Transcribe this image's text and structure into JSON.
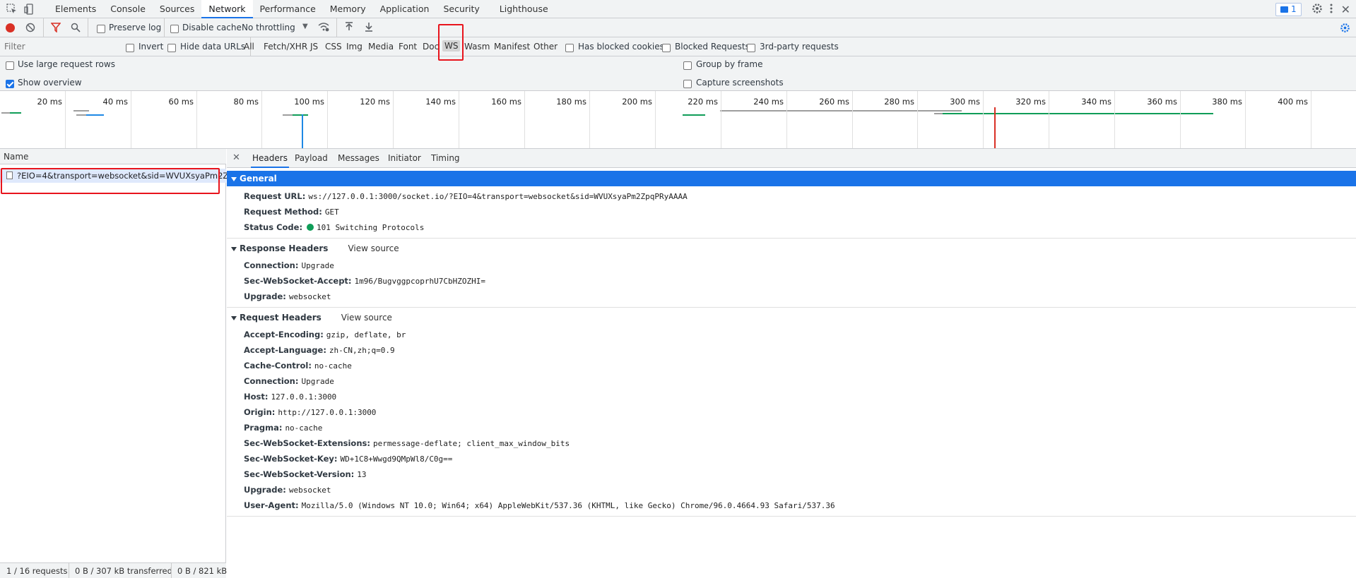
{
  "devtools": {
    "tabs": [
      "Elements",
      "Console",
      "Sources",
      "Network",
      "Performance",
      "Memory",
      "Application",
      "Security",
      "Lighthouse"
    ],
    "active_tab": "Network",
    "issues_badge": "1"
  },
  "toolbar": {
    "preserve_log": "Preserve log",
    "disable_cache": "Disable cache",
    "throttling": "No throttling"
  },
  "filter": {
    "placeholder": "Filter",
    "invert": "Invert",
    "hide_data_urls": "Hide data URLs",
    "types": [
      "All",
      "Fetch/XHR",
      "JS",
      "CSS",
      "Img",
      "Media",
      "Font",
      "Doc",
      "WS",
      "Wasm",
      "Manifest",
      "Other"
    ],
    "active_type": "WS",
    "has_blocked_cookies": "Has blocked cookies",
    "blocked_requests": "Blocked Requests",
    "third_party": "3rd-party requests"
  },
  "options": {
    "large_rows": "Use large request rows",
    "show_overview": "Show overview",
    "group_by_frame": "Group by frame",
    "capture_screenshots": "Capture screenshots"
  },
  "overview": {
    "ticks": [
      "20 ms",
      "40 ms",
      "60 ms",
      "80 ms",
      "100 ms",
      "120 ms",
      "140 ms",
      "160 ms",
      "180 ms",
      "200 ms",
      "220 ms",
      "240 ms",
      "260 ms",
      "280 ms",
      "300 ms",
      "320 ms",
      "340 ms",
      "360 ms",
      "380 ms",
      "400 ms",
      "4..."
    ]
  },
  "requests": {
    "header": "Name",
    "rows": [
      "?EIO=4&transport=websocket&sid=WVUXsyaPm2Z..."
    ],
    "status": {
      "count": "1 / 16 requests",
      "transferred": "0 B / 307 kB transferred",
      "resources": "0 B / 821 kB"
    }
  },
  "detail": {
    "tabs": [
      "Headers",
      "Payload",
      "Messages",
      "Initiator",
      "Timing"
    ],
    "active_tab": "Headers",
    "general": {
      "title": "General",
      "rows": [
        {
          "k": "Request URL:",
          "v": "ws://127.0.0.1:3000/socket.io/?EIO=4&transport=websocket&sid=WVUXsyaPm2ZpqPRyAAAA"
        },
        {
          "k": "Request Method:",
          "v": "GET"
        },
        {
          "k": "Status Code:",
          "v": "101 Switching Protocols"
        }
      ]
    },
    "response_headers": {
      "title": "Response Headers",
      "view_source": "View source",
      "rows": [
        {
          "k": "Connection:",
          "v": "Upgrade"
        },
        {
          "k": "Sec-WebSocket-Accept:",
          "v": "1m96/BugvggpcoprhU7CbHZOZHI="
        },
        {
          "k": "Upgrade:",
          "v": "websocket"
        }
      ]
    },
    "request_headers": {
      "title": "Request Headers",
      "view_source": "View source",
      "rows": [
        {
          "k": "Accept-Encoding:",
          "v": "gzip, deflate, br"
        },
        {
          "k": "Accept-Language:",
          "v": "zh-CN,zh;q=0.9"
        },
        {
          "k": "Cache-Control:",
          "v": "no-cache"
        },
        {
          "k": "Connection:",
          "v": "Upgrade"
        },
        {
          "k": "Host:",
          "v": "127.0.0.1:3000"
        },
        {
          "k": "Origin:",
          "v": "http://127.0.0.1:3000"
        },
        {
          "k": "Pragma:",
          "v": "no-cache"
        },
        {
          "k": "Sec-WebSocket-Extensions:",
          "v": "permessage-deflate; client_max_window_bits"
        },
        {
          "k": "Sec-WebSocket-Key:",
          "v": "WD+1C8+Wwgd9QMpWl8/C0g=="
        },
        {
          "k": "Sec-WebSocket-Version:",
          "v": "13"
        },
        {
          "k": "Upgrade:",
          "v": "websocket"
        },
        {
          "k": "User-Agent:",
          "v": "Mozilla/5.0 (Windows NT 10.0; Win64; x64) AppleWebKit/537.36 (KHTML, like Gecko) Chrome/96.0.4664.93 Safari/537.36"
        }
      ]
    }
  },
  "colors": {
    "accent": "#1a73e8",
    "record_red": "#d93025",
    "status_green": "#0f9d58",
    "highlight_red": "#e8141c"
  }
}
